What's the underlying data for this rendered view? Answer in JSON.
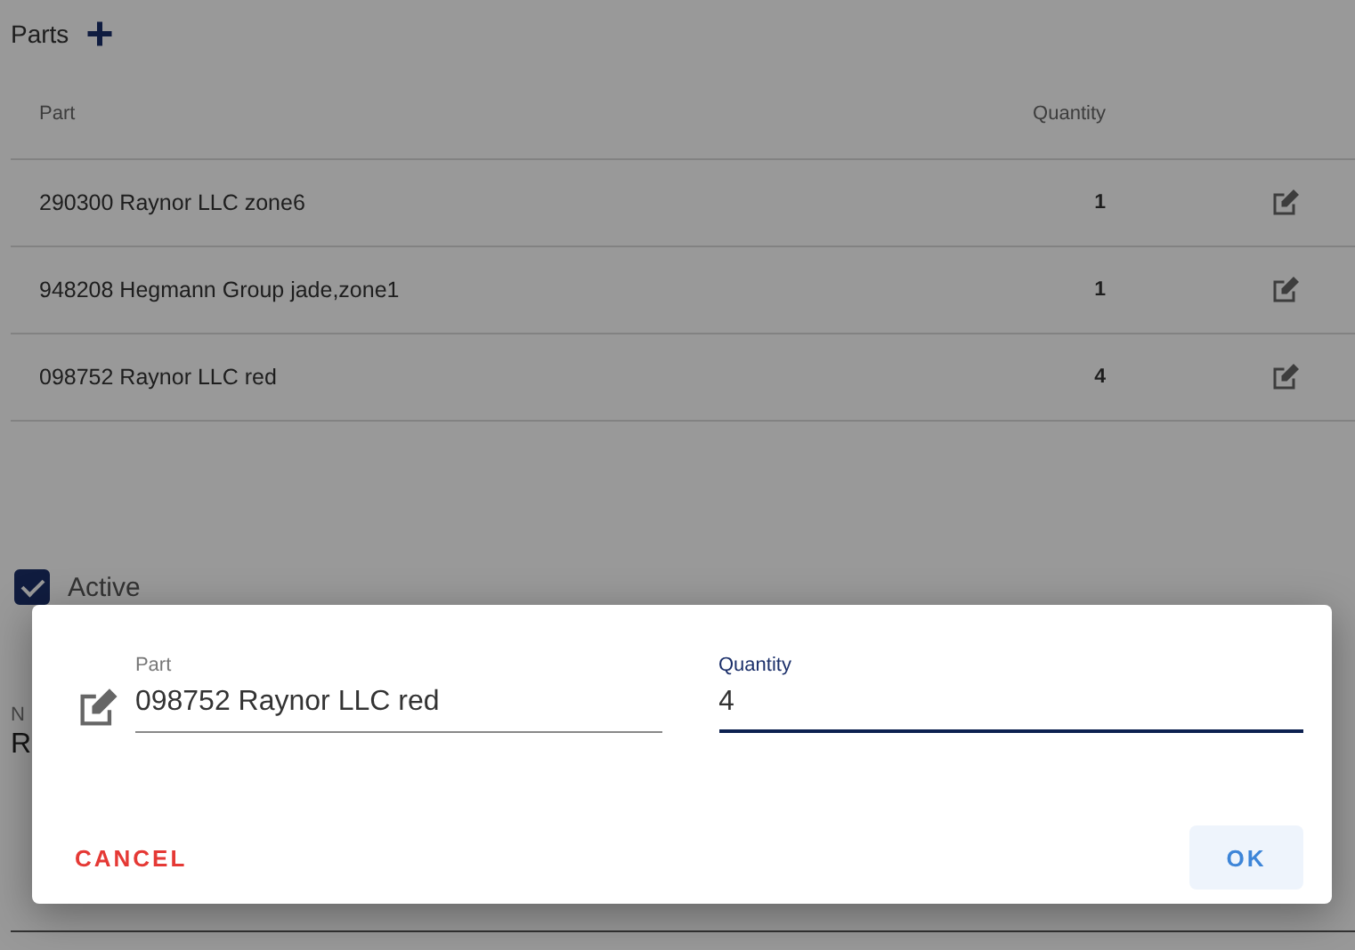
{
  "section": {
    "title": "Parts"
  },
  "table": {
    "columns": [
      "Part",
      "Quantity"
    ],
    "rows": [
      {
        "part": "290300 Raynor LLC zone6",
        "quantity": "1"
      },
      {
        "part": "948208 Hegmann Group jade,zone1",
        "quantity": "1"
      },
      {
        "part": "098752 Raynor LLC red",
        "quantity": "4"
      }
    ]
  },
  "active_checkbox": {
    "label": "Active",
    "checked": true
  },
  "background_field": {
    "label": "N",
    "value": "R"
  },
  "dialog": {
    "fields": [
      {
        "kind": "text",
        "label": "Part",
        "value": "098752 Raynor LLC red",
        "focused": false
      },
      {
        "kind": "number",
        "label": "Quantity",
        "value": "4",
        "focused": true
      }
    ],
    "buttons": [
      {
        "kind": "cancel",
        "label": "CANCEL"
      },
      {
        "kind": "ok",
        "label": "OK"
      }
    ]
  }
}
